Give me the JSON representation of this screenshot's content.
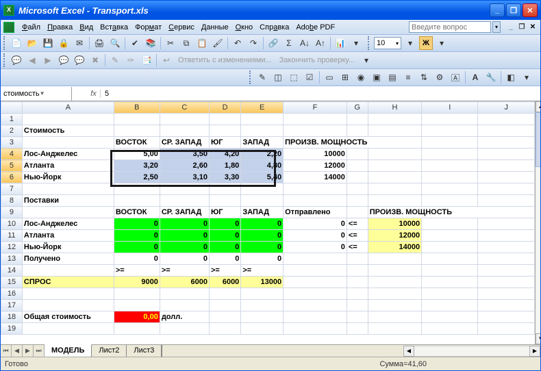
{
  "window": {
    "title": "Microsoft Excel - Transport.xls"
  },
  "menu": {
    "file": "Файл",
    "edit": "Правка",
    "view": "Вид",
    "insert": "Вставка",
    "format": "Формат",
    "service": "Сервис",
    "data": "Данные",
    "window": "Окно",
    "help": "Справка",
    "adobe": "Adobe PDF"
  },
  "ask_placeholder": "Введите вопрос",
  "format_toolbar": {
    "fontsize": "10",
    "bold": "Ж"
  },
  "review": {
    "reply": "Ответить с изменениями...",
    "finish": "Закончить проверку..."
  },
  "namebox": "стоимость",
  "fx": "fx",
  "formula": "5",
  "cols": [
    "A",
    "B",
    "C",
    "D",
    "E",
    "F",
    "G",
    "H",
    "I",
    "J"
  ],
  "rows_shown": 19,
  "sheet": {
    "A2": "Стоимость",
    "B3": "ВОСТОК",
    "C3": "СР. ЗАПАД",
    "D3": "ЮГ",
    "E3": "ЗАПАД",
    "F3": "ПРОИЗВ. МОЩНОСТЬ",
    "A4": "Лос-Анджелес",
    "B4": "5,00",
    "C4": "3,50",
    "D4": "4,20",
    "E4": "2,20",
    "F4": "10000",
    "A5": "Атланта",
    "B5": "3,20",
    "C5": "2,60",
    "D5": "1,80",
    "E5": "4,80",
    "F5": "12000",
    "A6": "Нью-Йорк",
    "B6": "2,50",
    "C6": "3,10",
    "D6": "3,30",
    "E6": "5,40",
    "F6": "14000",
    "A8": "Поставки",
    "B9": "ВОСТОК",
    "C9": "СР. ЗАПАД",
    "D9": "ЮГ",
    "E9": "ЗАПАД",
    "F9": "Отправлено",
    "H9": "ПРОИЗВ. МОЩНОСТЬ",
    "A10": "Лос-Анджелес",
    "B10": "0",
    "C10": "0",
    "D10": "0",
    "E10": "0",
    "F10": "0",
    "G10": "<=",
    "H10": "10000",
    "A11": "Атланта",
    "B11": "0",
    "C11": "0",
    "D11": "0",
    "E11": "0",
    "F11": "0",
    "G11": "<=",
    "H11": "12000",
    "A12": "Нью-Йорк",
    "B12": "0",
    "C12": "0",
    "D12": "0",
    "E12": "0",
    "F12": "0",
    "G12": "<=",
    "H12": "14000",
    "A13": "Получено",
    "B13": "0",
    "C13": "0",
    "D13": "0",
    "E13": "0",
    "B14": ">=",
    "C14": ">=",
    "D14": ">=",
    "E14": ">=",
    "A15": "СПРОС",
    "B15": "9000",
    "C15": "6000",
    "D15": "6000",
    "E15": "13000",
    "A18": "Общая стоимость",
    "B18": "0,00",
    "C18": "долл."
  },
  "tabs": {
    "t1": "МОДЕЛЬ",
    "t2": "Лист2",
    "t3": "Лист3"
  },
  "status": {
    "ready": "Готово",
    "sum": "Сумма=41,60"
  }
}
